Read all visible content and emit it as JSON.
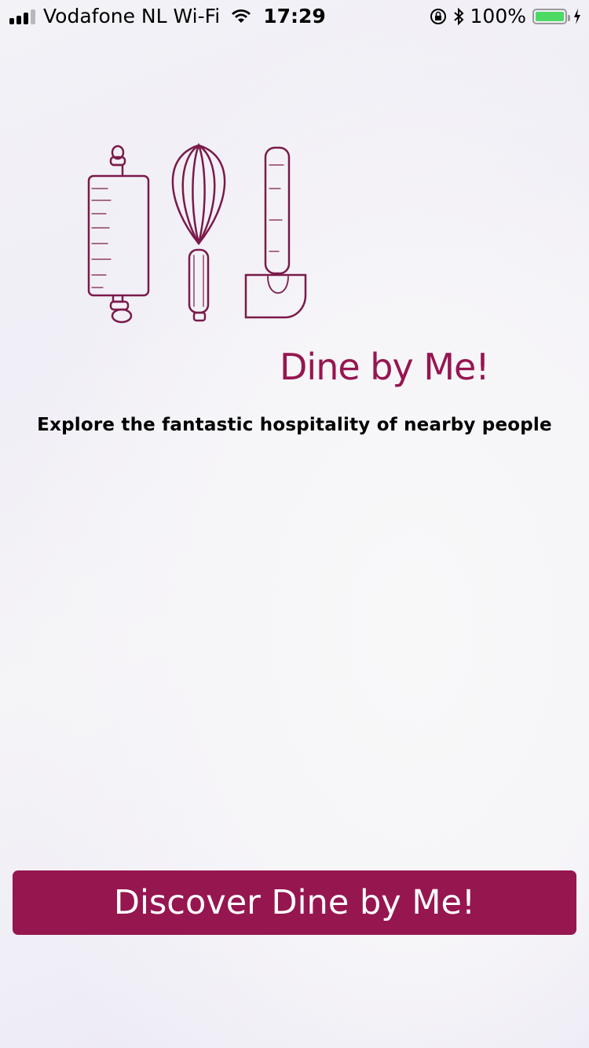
{
  "status_bar": {
    "carrier": "Vodafone NL Wi-Fi",
    "time": "17:29",
    "battery_percent": "100%",
    "battery_color": "#4cd964",
    "icons": [
      "signal-icon",
      "wifi-icon",
      "orientation-lock-icon",
      "bluetooth-icon",
      "battery-icon",
      "charging-icon"
    ]
  },
  "hero": {
    "illustration": [
      "rolling-pin-icon",
      "whisk-icon",
      "spatula-icon"
    ],
    "app_name": "Dine by Me!",
    "tagline": "Explore the fantastic hospitality of nearby people"
  },
  "cta": {
    "label": "Discover Dine by Me!"
  },
  "colors": {
    "brand": "#961650",
    "text": "#000000",
    "button_text": "#ffffff"
  }
}
